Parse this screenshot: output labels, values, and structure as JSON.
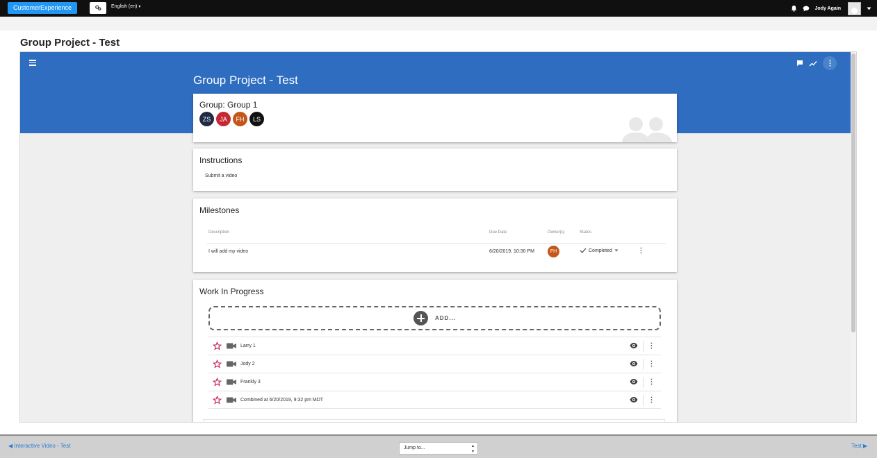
{
  "topnav": {
    "brand": "CustomerExperience",
    "language": "English (en)",
    "user_name": "Jody Again"
  },
  "page": {
    "title": "Group Project - Test"
  },
  "banner": {
    "title": "Group Project - Test"
  },
  "group_card": {
    "title": "Group: Group 1",
    "members": [
      {
        "initials": "ZS",
        "color": "#1f2a44"
      },
      {
        "initials": "JA",
        "color": "#c62833"
      },
      {
        "initials": "FH",
        "color": "#c4561a"
      },
      {
        "initials": "LS",
        "color": "#111111"
      }
    ]
  },
  "instructions": {
    "title": "Instructions",
    "text": "Submit a video"
  },
  "milestones": {
    "title": "Milestones",
    "columns": [
      "Description",
      "Due Date",
      "Owner(s)",
      "Status"
    ],
    "rows": [
      {
        "description": "I will add my video",
        "due_date": "6/20/2019, 10:30 PM",
        "owner_initials": "FH",
        "status": "Completed"
      }
    ]
  },
  "wip": {
    "title": "Work In Progress",
    "add_label": "ADD...",
    "items": [
      {
        "name": "Larry 1"
      },
      {
        "name": "Jody 2"
      },
      {
        "name": "Frankly 3"
      },
      {
        "name": "Combined at 6/20/2019, 9:32 pm MDT"
      }
    ]
  },
  "bottombar": {
    "prev": "Interactive Video - Test",
    "jump": "Jump to...",
    "next": "Test"
  },
  "colors": {
    "brand_blue": "#2196f3",
    "banner_blue": "#2e6dc0",
    "link_blue": "#2b7cd3",
    "star_red": "#c2185b"
  }
}
